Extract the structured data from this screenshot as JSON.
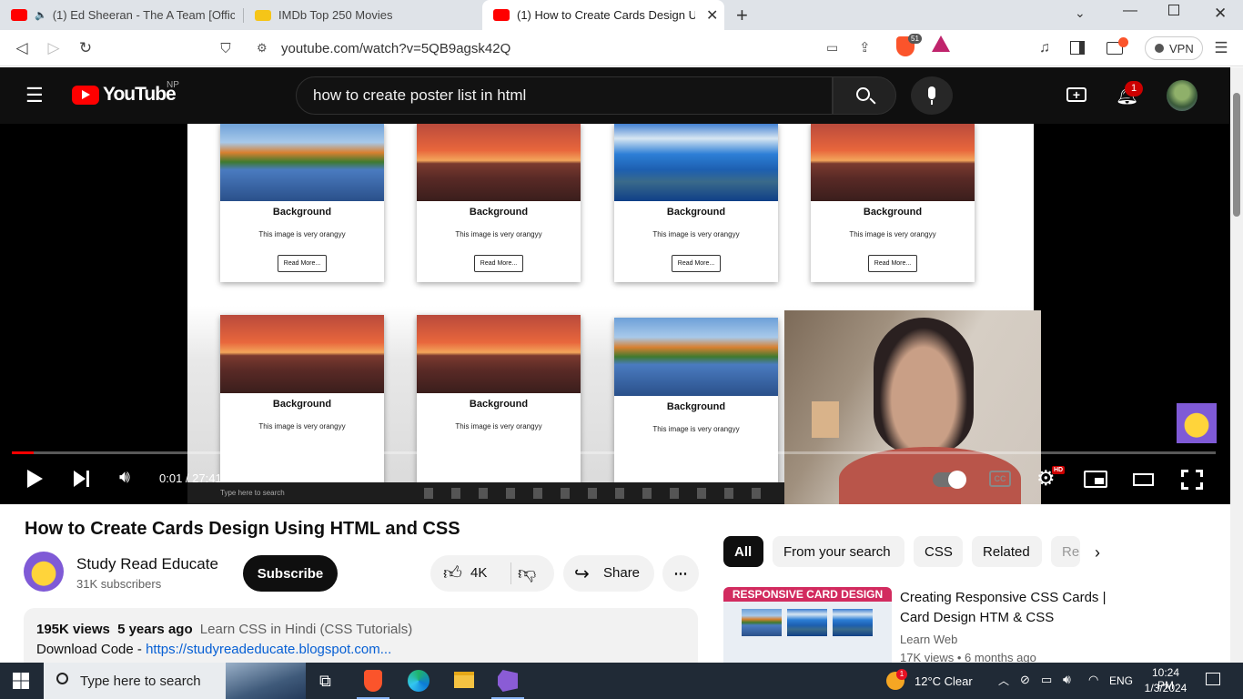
{
  "browser": {
    "tabs": [
      {
        "title": "(1) Ed Sheeran - The A Team [Offic",
        "active": false,
        "favicon": "youtube-favicon"
      },
      {
        "title": "IMDb Top 250 Movies",
        "active": false,
        "favicon": "imdb-favicon"
      },
      {
        "title": "(1) How to Create Cards Design U",
        "active": true,
        "favicon": "youtube-favicon"
      }
    ],
    "new_tab_icon": "+",
    "url": "youtube.com/watch?v=5QB9agsk42Q",
    "brave_shield_count": "51",
    "vpn_label": "VPN"
  },
  "youtube": {
    "logo_text": "YouTube",
    "region": "NP",
    "search_query": "how to create poster list in html",
    "notification_count": "1"
  },
  "video": {
    "cards_row1": [
      {
        "title": "Background",
        "desc": "This image is very orangyy",
        "button": "Read More...",
        "image": "lake"
      },
      {
        "title": "Background",
        "desc": "This image is very orangyy",
        "button": "Read More...",
        "image": "sunset"
      },
      {
        "title": "Background",
        "desc": "This image is very orangyy",
        "button": "Read More...",
        "image": "glacier"
      },
      {
        "title": "Background",
        "desc": "This image is very orangyy",
        "button": "Read More...",
        "image": "sunset"
      }
    ],
    "cards_row2": [
      {
        "title": "Background",
        "desc": "This image is very orangyy",
        "image": "sunset"
      },
      {
        "title": "Background",
        "desc": "This image is very orangyy",
        "image": "sunset"
      },
      {
        "title": "Background",
        "desc": "This image is very orangyy",
        "image": "lake"
      }
    ],
    "inner_taskbar_search": "Type here to search",
    "time_current": "0:01",
    "time_total": "27:41",
    "time_separator": " / ",
    "hd_badge": "HD",
    "progress_fraction": 0.0006
  },
  "info": {
    "title": "How to Create Cards Design Using HTML and CSS",
    "channel": "Study Read Educate",
    "subscribers": "31K subscribers",
    "subscribe_label": "Subscribe",
    "likes": "4K",
    "share_label": "Share",
    "more_label": "⋯",
    "views": "195K views",
    "age": "5 years ago",
    "playlist": "Learn CSS in Hindi (CSS Tutorials)",
    "download_label": "Download Code - ",
    "download_link": "https://studyreadeducate.blogspot.com..."
  },
  "sidebar": {
    "chips": [
      "All",
      "From your search",
      "CSS",
      "Related",
      "Re"
    ],
    "recommended": {
      "thumb_banner": "RESPONSIVE CARD DESIGN",
      "title": "Creating Responsive CSS Cards | Card Design HTM & CSS",
      "channel": "Learn Web",
      "meta": "17K views • 6 months ago"
    }
  },
  "windows": {
    "search_placeholder": "Type here to search",
    "weather": "12°C  Clear",
    "weather_badge": "1",
    "language": "ENG",
    "time": "10:24 PM",
    "date": "1/3/2024"
  },
  "colors": {
    "youtube_red": "#ff0000",
    "brave_orange": "#fb542b",
    "link_blue": "#065fd4"
  }
}
